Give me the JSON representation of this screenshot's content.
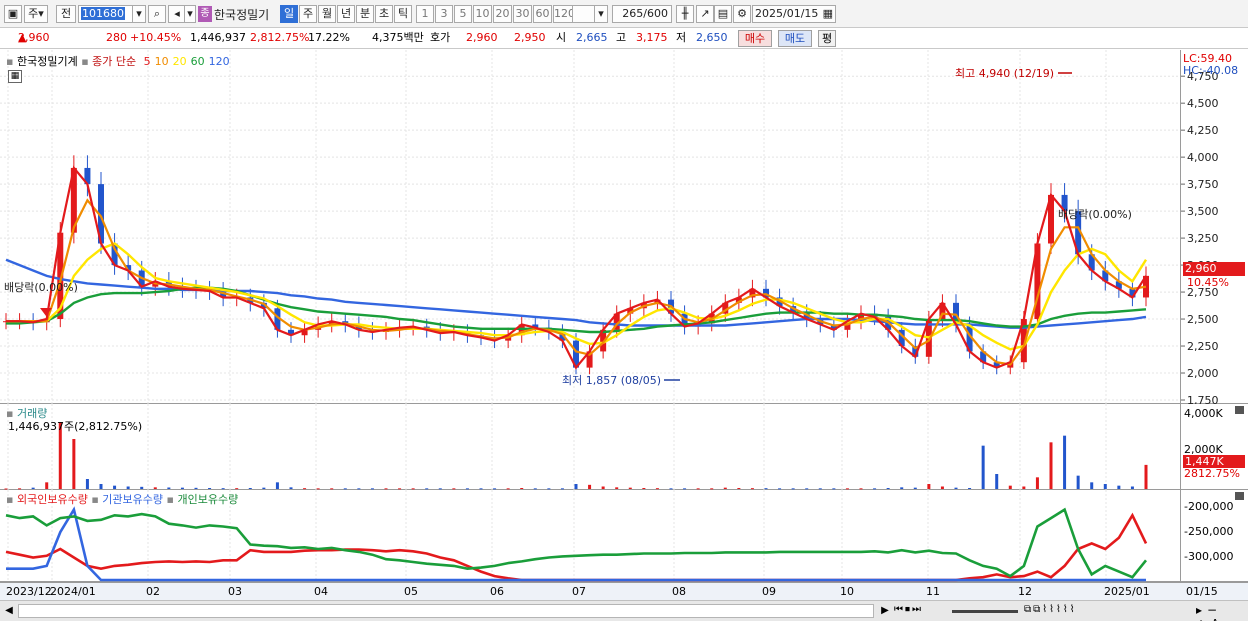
{
  "toolbar": {
    "mode": "주",
    "type": "전",
    "code": "101680",
    "stock_name": "한국정밀기",
    "period_buttons": [
      "일",
      "주",
      "월",
      "년",
      "분",
      "초",
      "틱"
    ],
    "minute_buttons": [
      "1",
      "3",
      "5",
      "10",
      "20",
      "30",
      "60",
      "120"
    ],
    "count": "265",
    "count_total": "/600",
    "date": "2025/01/15"
  },
  "quote": {
    "price": "2,960",
    "change": "280",
    "change_pct": "+10.45%",
    "volume": "1,446,937",
    "volume_pct": "2,812.75%",
    "turnover_pct": "17.22%",
    "amount": "4,375백만",
    "bid_label": "호가",
    "ask_price": "2,960",
    "bid_price": "2,950",
    "open_label": "시",
    "open": "2,665",
    "high_label": "고",
    "high": "3,175",
    "low_label": "저",
    "low": "2,650",
    "buy_label": "매수",
    "sell_label": "매도",
    "eval_label": "평"
  },
  "price_panel": {
    "name": "한국정밀기계",
    "ma_label": "종가 단순",
    "ma_periods": [
      "5",
      "10",
      "20",
      "60",
      "120"
    ],
    "ma_colors": [
      "#e31a1c",
      "#f08c00",
      "#ffe600",
      "#1a9e3a",
      "#3366e0"
    ],
    "lc": "LC:59.40",
    "hc": "HC:-40.08",
    "y_ticks": [
      "4,750",
      "4,500",
      "4,250",
      "4,000",
      "3,750",
      "3,500",
      "3,250",
      "3,000",
      "2,750",
      "2,500",
      "2,250",
      "2,000",
      "1,750"
    ],
    "last_price_tag": "2,960",
    "last_pct_tag": "10.45%",
    "high_annotation": "최고 4,940 (12/19)",
    "low_annotation": "최저 1,857 (08/05)",
    "dividend_left": "배당락(0.00%)",
    "dividend_right": "배당락(0.00%)"
  },
  "volume_panel": {
    "name": "거래량",
    "value_label": "1,446,937주(2,812.75%)",
    "y_ticks": [
      "4,000K",
      "2,000K"
    ],
    "last_tag": "1,447K",
    "last_pct_tag": "2812.75%"
  },
  "holder_panel": {
    "foreign": "외국인보유수량",
    "institution": "기관보유수량",
    "individual": "개인보유수량",
    "y_ticks": [
      "-200,000",
      "-250,000",
      "-300,000"
    ]
  },
  "x_axis": {
    "labels": [
      "2023/12",
      "2024/01",
      "02",
      "03",
      "04",
      "05",
      "06",
      "07",
      "08",
      "09",
      "10",
      "11",
      "12",
      "2025/01"
    ],
    "right_label": "01/15"
  },
  "chart_data": [
    {
      "type": "line",
      "title": "한국정밀기계",
      "series": [
        {
          "name": "5",
          "color": "#e31a1c",
          "values": [
            2480,
            2480,
            2470,
            2500,
            3300,
            3900,
            3750,
            3200,
            3000,
            2950,
            2800,
            2850,
            2800,
            2780,
            2770,
            2760,
            2700,
            2700,
            2650,
            2600,
            2400,
            2350,
            2400,
            2450,
            2480,
            2450,
            2400,
            2380,
            2400,
            2420,
            2430,
            2400,
            2370,
            2380,
            2350,
            2330,
            2300,
            2350,
            2450,
            2420,
            2380,
            2300,
            2050,
            2200,
            2400,
            2550,
            2600,
            2650,
            2680,
            2550,
            2430,
            2460,
            2550,
            2650,
            2700,
            2780,
            2700,
            2620,
            2560,
            2500,
            2450,
            2400,
            2480,
            2550,
            2520,
            2400,
            2250,
            2150,
            2500,
            2650,
            2450,
            2200,
            2100,
            2050,
            2100,
            2500,
            3200,
            3650,
            3500,
            3100,
            2950,
            2850,
            2780,
            2700,
            2900
          ]
        },
        {
          "name": "10",
          "color": "#f08c00",
          "values": [
            2480,
            2480,
            2480,
            2480,
            2850,
            3350,
            3600,
            3450,
            3150,
            2950,
            2880,
            2830,
            2820,
            2800,
            2780,
            2770,
            2740,
            2710,
            2680,
            2640,
            2520,
            2430,
            2400,
            2420,
            2450,
            2460,
            2430,
            2400,
            2390,
            2400,
            2420,
            2410,
            2390,
            2380,
            2360,
            2340,
            2320,
            2330,
            2380,
            2410,
            2400,
            2360,
            2200,
            2170,
            2280,
            2450,
            2560,
            2620,
            2650,
            2620,
            2500,
            2470,
            2500,
            2580,
            2660,
            2720,
            2730,
            2670,
            2600,
            2540,
            2480,
            2440,
            2450,
            2500,
            2520,
            2470,
            2350,
            2230,
            2300,
            2550,
            2540,
            2350,
            2200,
            2100,
            2080,
            2250,
            2700,
            3150,
            3350,
            3350,
            3100,
            2950,
            2850,
            2780,
            2800
          ]
        },
        {
          "name": "20",
          "color": "#ffe600",
          "values": [
            2480,
            2480,
            2480,
            2480,
            2600,
            2900,
            3050,
            3150,
            3200,
            3100,
            2980,
            2880,
            2850,
            2830,
            2810,
            2790,
            2770,
            2750,
            2720,
            2690,
            2620,
            2540,
            2470,
            2440,
            2440,
            2450,
            2450,
            2430,
            2420,
            2410,
            2410,
            2410,
            2400,
            2390,
            2380,
            2370,
            2350,
            2350,
            2360,
            2380,
            2390,
            2380,
            2320,
            2270,
            2280,
            2350,
            2440,
            2520,
            2580,
            2600,
            2560,
            2510,
            2500,
            2530,
            2580,
            2640,
            2680,
            2680,
            2650,
            2600,
            2550,
            2500,
            2470,
            2470,
            2500,
            2500,
            2430,
            2350,
            2330,
            2400,
            2470,
            2440,
            2350,
            2280,
            2220,
            2250,
            2450,
            2750,
            2950,
            3100,
            3150,
            3100,
            2950,
            2850,
            3050
          ]
        },
        {
          "name": "60",
          "color": "#1a9e3a",
          "values": [
            2460,
            2460,
            2470,
            2480,
            2550,
            2650,
            2700,
            2730,
            2740,
            2740,
            2740,
            2750,
            2760,
            2780,
            2790,
            2790,
            2780,
            2760,
            2720,
            2680,
            2640,
            2610,
            2590,
            2570,
            2560,
            2550,
            2540,
            2530,
            2520,
            2500,
            2490,
            2470,
            2450,
            2430,
            2420,
            2410,
            2410,
            2410,
            2410,
            2410,
            2410,
            2400,
            2390,
            2380,
            2380,
            2390,
            2400,
            2410,
            2430,
            2440,
            2450,
            2460,
            2470,
            2490,
            2510,
            2530,
            2550,
            2560,
            2560,
            2560,
            2560,
            2550,
            2550,
            2540,
            2540,
            2530,
            2520,
            2500,
            2490,
            2490,
            2490,
            2480,
            2460,
            2440,
            2430,
            2430,
            2450,
            2500,
            2530,
            2550,
            2560,
            2560,
            2570,
            2580,
            2590
          ]
        },
        {
          "name": "120",
          "color": "#3366e0",
          "values": [
            3050,
            3000,
            2950,
            2900,
            2870,
            2850,
            2830,
            2820,
            2810,
            2800,
            2790,
            2780,
            2780,
            2770,
            2770,
            2770,
            2760,
            2760,
            2760,
            2750,
            2740,
            2720,
            2710,
            2690,
            2680,
            2660,
            2650,
            2640,
            2630,
            2620,
            2610,
            2600,
            2590,
            2580,
            2570,
            2560,
            2550,
            2540,
            2530,
            2520,
            2510,
            2500,
            2490,
            2470,
            2460,
            2450,
            2440,
            2440,
            2440,
            2440,
            2440,
            2440,
            2440,
            2440,
            2450,
            2460,
            2470,
            2480,
            2490,
            2500,
            2500,
            2500,
            2500,
            2490,
            2480,
            2470,
            2460,
            2450,
            2450,
            2450,
            2450,
            2450,
            2440,
            2430,
            2420,
            2420,
            2430,
            2440,
            2450,
            2460,
            2470,
            2480,
            2490,
            2500,
            2520
          ]
        }
      ],
      "ylim": [
        1750,
        4900
      ]
    },
    {
      "type": "bar",
      "title": "거래량",
      "values_k": [
        30,
        40,
        80,
        400,
        4000,
        3000,
        600,
        300,
        200,
        150,
        130,
        100,
        90,
        80,
        70,
        60,
        50,
        50,
        60,
        80,
        400,
        100,
        50,
        40,
        40,
        40,
        40,
        40,
        40,
        40,
        40,
        40,
        40,
        40,
        40,
        40,
        40,
        40,
        60,
        40,
        40,
        40,
        300,
        250,
        150,
        100,
        80,
        60,
        50,
        40,
        40,
        40,
        40,
        80,
        60,
        50,
        50,
        40,
        40,
        40,
        40,
        40,
        40,
        40,
        40,
        60,
        100,
        80,
        300,
        150,
        80,
        60,
        2600,
        900,
        200,
        150,
        700,
        2800,
        3200,
        800,
        400,
        300,
        200,
        150,
        1447
      ],
      "ylim": [
        0,
        4500
      ]
    },
    {
      "type": "line",
      "title": "보유수량",
      "series": [
        {
          "name": "외국인보유수량",
          "color": "#e31a1c",
          "values": [
            -275000,
            -280000,
            -285000,
            -282000,
            -270000,
            -285000,
            -300000,
            -305000,
            -300000,
            -298000,
            -295000,
            -293000,
            -292000,
            -293000,
            -292000,
            -293000,
            -290000,
            -290000,
            -272000,
            -275000,
            -275000,
            -275000,
            -273000,
            -272000,
            -272000,
            -271000,
            -271000,
            -272000,
            -274000,
            -272000,
            -274000,
            -278000,
            -285000,
            -290000,
            -300000,
            -310000,
            -318000,
            -322000,
            -325000,
            -325000,
            -325000,
            -325000,
            -325000,
            -325000,
            -325000,
            -325000,
            -325000,
            -325000,
            -325000,
            -325000,
            -325000,
            -325000,
            -325000,
            -325000,
            -325000,
            -325000,
            -325000,
            -325000,
            -325000,
            -325000,
            -325000,
            -325000,
            -325000,
            -325000,
            -325000,
            -325000,
            -325000,
            -325000,
            -325000,
            -325000,
            -325000,
            -322000,
            -320000,
            -315000,
            -320000,
            -318000,
            -310000,
            -320000,
            -300000,
            -270000,
            -260000,
            -270000,
            -250000,
            -210000,
            -260000
          ]
        },
        {
          "name": "기관보유수량",
          "color": "#3366e0",
          "values": [
            -305000,
            -305000,
            -305000,
            -300000,
            -240000,
            -200000,
            -300000,
            -325000,
            -325000,
            -325000,
            -325000,
            -325000,
            -325000,
            -325000,
            -325000,
            -325000,
            -325000,
            -325000,
            -325000,
            -325000,
            -325000,
            -325000,
            -325000,
            -325000,
            -325000,
            -325000,
            -325000,
            -325000,
            -325000,
            -325000,
            -325000,
            -325000,
            -325000,
            -325000,
            -325000,
            -325000,
            -325000,
            -325000,
            -325000,
            -325000,
            -325000,
            -325000,
            -325000,
            -325000,
            -325000,
            -325000,
            -325000,
            -325000,
            -325000,
            -325000,
            -325000,
            -325000,
            -325000,
            -325000,
            -325000,
            -325000,
            -325000,
            -325000,
            -325000,
            -325000,
            -325000,
            -325000,
            -325000,
            -325000,
            -325000,
            -325000,
            -325000,
            -325000,
            -325000,
            -325000,
            -325000,
            -325000,
            -325000,
            -325000,
            -325000,
            -325000,
            -325000,
            -325000,
            -325000,
            -325000,
            -325000,
            -325000,
            -325000,
            -325000,
            -325000
          ]
        },
        {
          "name": "개인보유수량",
          "color": "#1a9e3a",
          "values": [
            -210000,
            -215000,
            -212000,
            -228000,
            -215000,
            -212000,
            -220000,
            -218000,
            -210000,
            -212000,
            -208000,
            -212000,
            -225000,
            -228000,
            -232000,
            -228000,
            -230000,
            -233000,
            -262000,
            -264000,
            -265000,
            -268000,
            -267000,
            -270000,
            -268000,
            -272000,
            -275000,
            -280000,
            -288000,
            -290000,
            -293000,
            -296000,
            -298000,
            -300000,
            -305000,
            -303000,
            -300000,
            -295000,
            -292000,
            -288000,
            -285000,
            -283000,
            -282000,
            -281000,
            -280000,
            -280000,
            -279000,
            -278000,
            -278000,
            -278000,
            -277000,
            -277000,
            -277000,
            -276000,
            -276000,
            -276000,
            -276000,
            -275000,
            -275000,
            -275000,
            -275000,
            -275000,
            -275000,
            -275000,
            -274000,
            -276000,
            -272000,
            -276000,
            -273000,
            -277000,
            -278000,
            -290000,
            -300000,
            -305000,
            -318000,
            -300000,
            -230000,
            -215000,
            -200000,
            -270000,
            -315000,
            -300000,
            -310000,
            -320000,
            -290000
          ]
        }
      ],
      "ylim": [
        -325000,
        -190000
      ]
    }
  ]
}
